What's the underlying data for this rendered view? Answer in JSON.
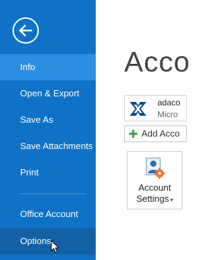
{
  "sidebar": {
    "back_label": "Back",
    "items": [
      {
        "label": "Info"
      },
      {
        "label": "Open & Export"
      },
      {
        "label": "Save As"
      },
      {
        "label": "Save Attachments"
      },
      {
        "label": "Print"
      },
      {
        "label": "Office Account"
      },
      {
        "label": "Options"
      }
    ],
    "selected_item": "Info",
    "hovered_item": "Options"
  },
  "main": {
    "heading": "Acco",
    "account": {
      "name": "adaco",
      "type": "Micro",
      "icon": "exchange-icon"
    },
    "add_account_label": "Add Acco",
    "settings_tile": {
      "line1": "Account",
      "line2": "Settings",
      "caret": "▾",
      "icon": "account-settings-icon"
    }
  },
  "colors": {
    "sidebar_bg": "#0f72c6",
    "selected_bg": "#2c8ee1",
    "hover_bg": "#1460a6",
    "heading_text": "#444444",
    "exchange_blue": "#0b4a8b",
    "gear_orange": "#e8762d"
  }
}
